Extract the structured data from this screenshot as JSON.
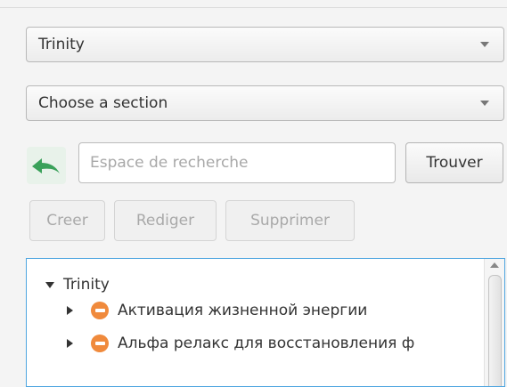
{
  "combo_project": {
    "value": "Trinity"
  },
  "combo_section": {
    "value": "Choose a section"
  },
  "search": {
    "placeholder": "Espace de recherche",
    "button_label": "Trouver"
  },
  "actions": {
    "create": "Creer",
    "edit": "Rediger",
    "delete": "Supprimer"
  },
  "tree": {
    "root": "Trinity",
    "items": [
      {
        "label": "Активация жизненной энергии",
        "icon": "orange-stop-icon"
      },
      {
        "label": "Альфа релакс для восстановления ф",
        "icon": "orange-stop-icon"
      }
    ]
  },
  "colors": {
    "tree_focus_border": "#4ea5e0",
    "item_icon": "#f08a3c",
    "back_arrow": "#3aa15a"
  }
}
